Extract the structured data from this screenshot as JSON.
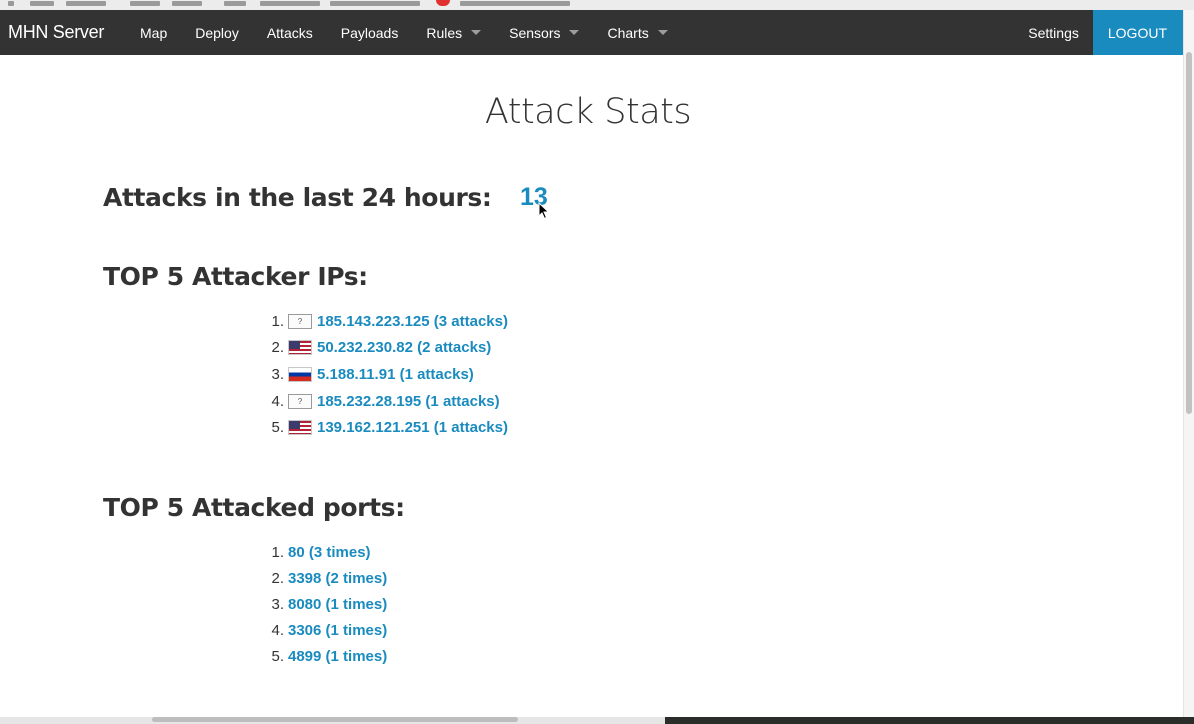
{
  "navbar": {
    "brand": "MHN Server",
    "items": [
      {
        "label": "Map",
        "dropdown": false
      },
      {
        "label": "Deploy",
        "dropdown": false
      },
      {
        "label": "Attacks",
        "dropdown": false
      },
      {
        "label": "Payloads",
        "dropdown": false
      },
      {
        "label": "Rules",
        "dropdown": true
      },
      {
        "label": "Sensors",
        "dropdown": true
      },
      {
        "label": "Charts",
        "dropdown": true
      }
    ],
    "settings": "Settings",
    "logout": "LOGOUT"
  },
  "page": {
    "title": "Attack Stats",
    "attacks_label": "Attacks in the last 24 hours:",
    "attacks_count": "13",
    "top_ips_label": "TOP 5 Attacker IPs:",
    "top_ports_label": "TOP 5 Attacked ports:"
  },
  "top_ips": [
    {
      "rank": "1.",
      "flag": "unknown-flag-icon",
      "flag_text": "?",
      "text": "185.143.223.125 (3 attacks)"
    },
    {
      "rank": "2.",
      "flag": "us-flag-icon",
      "flag_text": "",
      "text": "50.232.230.82 (2 attacks)"
    },
    {
      "rank": "3.",
      "flag": "ru-flag-icon",
      "flag_text": "",
      "text": "5.188.11.91 (1 attacks)"
    },
    {
      "rank": "4.",
      "flag": "unknown-flag-icon",
      "flag_text": "?",
      "text": "185.232.28.195 (1 attacks)"
    },
    {
      "rank": "5.",
      "flag": "us-flag-icon",
      "flag_text": "",
      "text": "139.162.121.251 (1 attacks)"
    }
  ],
  "top_ports": [
    {
      "rank": "1.",
      "text": "80 (3 times)"
    },
    {
      "rank": "2.",
      "text": "3398 (2 times)"
    },
    {
      "rank": "3.",
      "text": "8080 (1 times)"
    },
    {
      "rank": "4.",
      "text": "3306 (1 times)"
    },
    {
      "rank": "5.",
      "text": "4899 (1 times)"
    }
  ],
  "colors": {
    "navbar_bg": "#333333",
    "accent": "#1a8bbf",
    "text": "#333333"
  }
}
